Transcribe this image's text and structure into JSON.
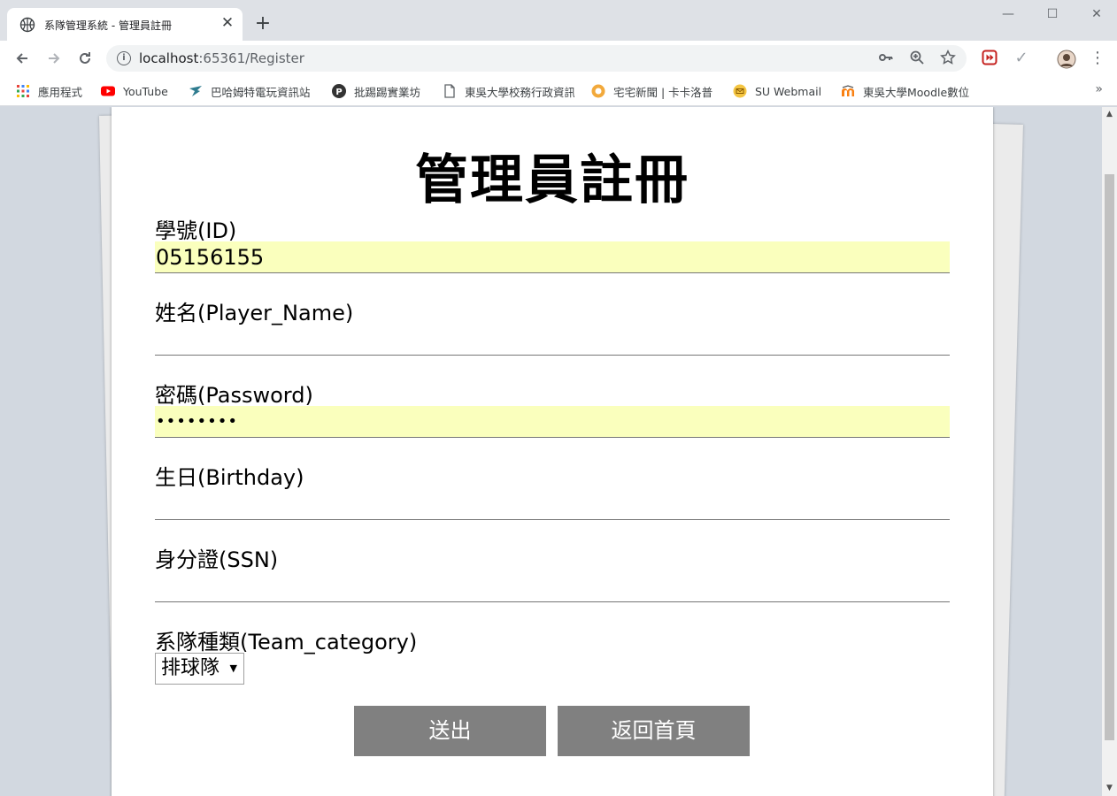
{
  "browser": {
    "tab_title": "系隊管理系統 - 管理員註冊",
    "tab_close": "✕",
    "new_tab": "+",
    "window_controls": {
      "minimize": "—",
      "maximize": "☐",
      "close": "✕"
    },
    "url_host": "localhost",
    "url_rest": ":65361/Register",
    "bookmarks": [
      {
        "label": "應用程式",
        "icon": "apps-grid-icon"
      },
      {
        "label": "YouTube",
        "icon": "youtube-icon"
      },
      {
        "label": "巴哈姆特電玩資訊站",
        "icon": "bahamut-icon"
      },
      {
        "label": "批踢踢實業坊",
        "icon": "ptt-icon"
      },
      {
        "label": "東吳大學校務行政資訊",
        "icon": "page-icon"
      },
      {
        "label": "宅宅新聞 | 卡卡洛普",
        "icon": "gamme-icon"
      },
      {
        "label": "SU Webmail",
        "icon": "webmail-icon"
      },
      {
        "label": "東吳大學Moodle數位",
        "icon": "moodle-icon"
      }
    ],
    "bookmarks_more": "»"
  },
  "form": {
    "title": "管理員註冊",
    "fields": {
      "student_id": {
        "label": "學號(ID)",
        "value": "05156155"
      },
      "name": {
        "label": "姓名(Player_Name)",
        "value": ""
      },
      "password": {
        "label": "密碼(Password)",
        "value": "••••••••"
      },
      "birthday": {
        "label": "生日(Birthday)",
        "value": ""
      },
      "ssn": {
        "label": "身分證(SSN)",
        "value": ""
      },
      "team_category": {
        "label": "系隊種類(Team_category)",
        "value": "排球隊"
      }
    },
    "submit_label": "送出",
    "home_label": "返回首頁"
  },
  "colors": {
    "autofill": "#faffbd",
    "button": "#808080",
    "page_background": "#d2d8e0"
  }
}
